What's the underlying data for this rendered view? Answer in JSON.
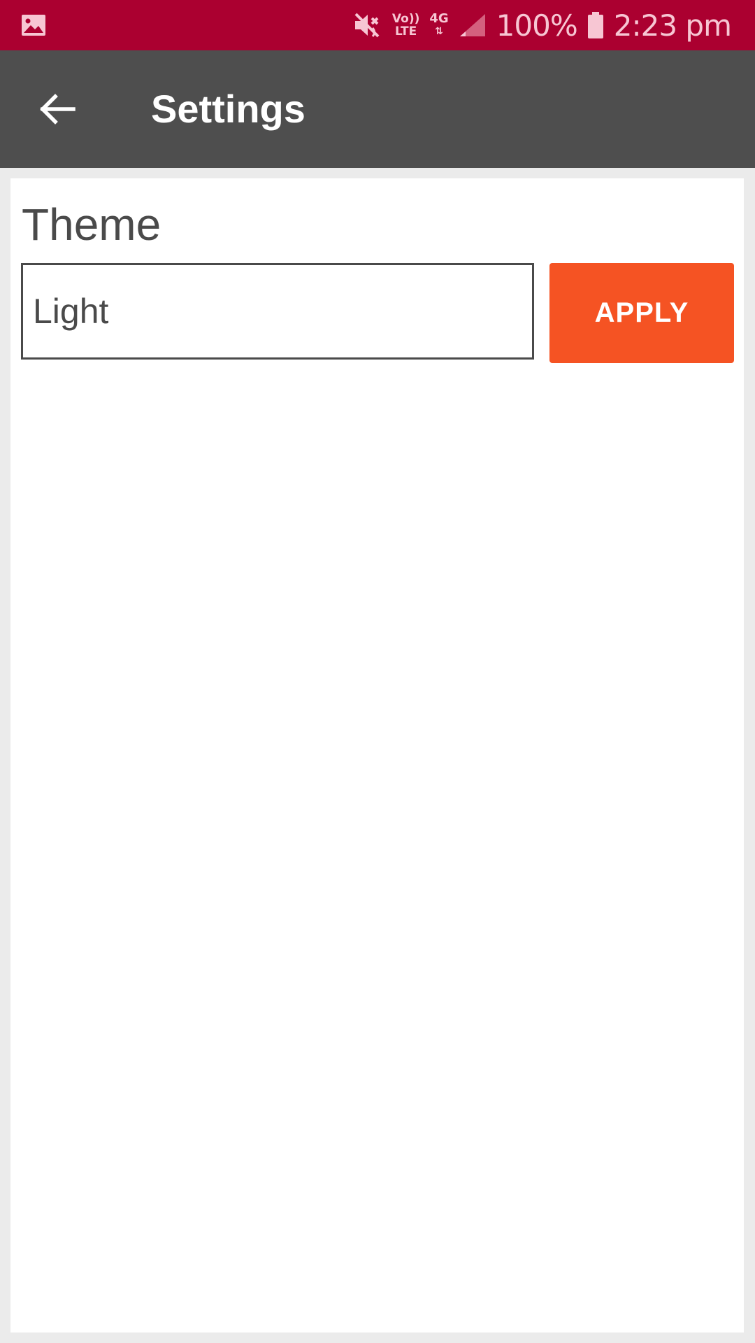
{
  "status_bar": {
    "left_icon": "gallery-icon",
    "icons": [
      "mute-icon",
      "volte-icon",
      "4g-icon",
      "signal-icon",
      "battery-icon"
    ],
    "volte_top": "Vo))",
    "volte_bottom": "LTE",
    "network": "4G",
    "battery": "100%",
    "time": "2:23 pm",
    "color": "#ab0030"
  },
  "app_bar": {
    "back_icon": "arrow-back-icon",
    "title": "Settings",
    "color": "#4e4e4e"
  },
  "theme_section": {
    "label": "Theme",
    "selected_value": "Light",
    "apply_label": "APPLY",
    "apply_color": "#f55323"
  }
}
